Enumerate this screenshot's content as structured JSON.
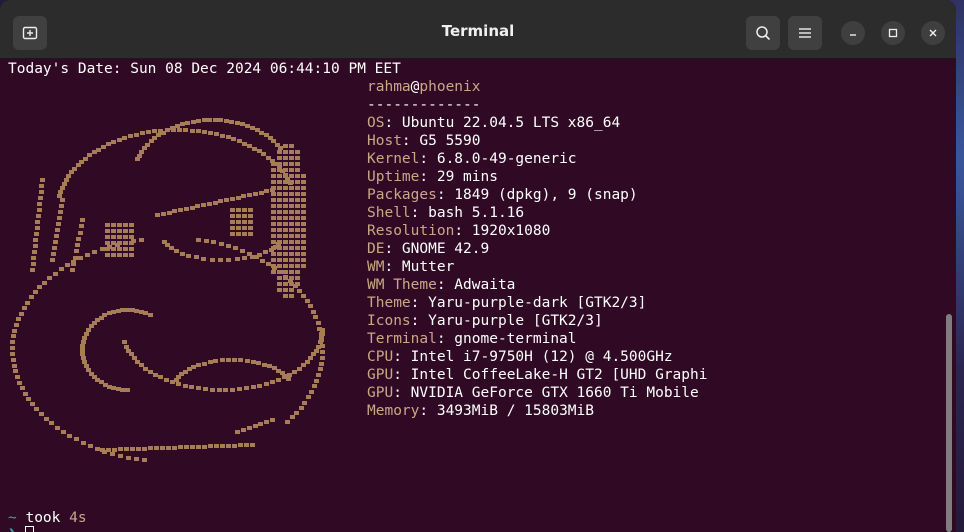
{
  "window": {
    "title": "Terminal",
    "new_tab_icon": "new-tab-icon",
    "search_icon": "search-icon",
    "menu_icon": "hamburger-menu-icon",
    "minimize_icon": "minimize-icon",
    "maximize_icon": "maximize-icon",
    "close_icon": "close-icon"
  },
  "terminal": {
    "date_line": "Today's Date: Sun 08 Dec 2024 06:44:10 PM EET",
    "user": "rahma",
    "at": "@",
    "host": "phoenix",
    "separator": "-------------",
    "info": [
      {
        "key": "OS",
        "value": ": Ubuntu 22.04.5 LTS x86_64"
      },
      {
        "key": "Host",
        "value": ": G5 5590"
      },
      {
        "key": "Kernel",
        "value": ": 6.8.0-49-generic"
      },
      {
        "key": "Uptime",
        "value": ": 29 mins"
      },
      {
        "key": "Packages",
        "value": ": 1849 (dpkg), 9 (snap)"
      },
      {
        "key": "Shell",
        "value": ": bash 5.1.16"
      },
      {
        "key": "Resolution",
        "value": ": 1920x1080"
      },
      {
        "key": "DE",
        "value": ": GNOME 42.9"
      },
      {
        "key": "WM",
        "value": ": Mutter"
      },
      {
        "key": "WM Theme",
        "value": ": Adwaita"
      },
      {
        "key": "Theme",
        "value": ": Yaru-purple-dark [GTK2/3]"
      },
      {
        "key": "Icons",
        "value": ": Yaru-purple [GTK2/3]"
      },
      {
        "key": "Terminal",
        "value": ": gnome-terminal"
      },
      {
        "key": "CPU",
        "value": ": Intel i7-9750H (12) @ 4.500GHz"
      },
      {
        "key": "GPU",
        "value": ": Intel CoffeeLake-H GT2 [UHD Graphi"
      },
      {
        "key": "GPU",
        "value": ": NVIDIA GeForce GTX 1660 Ti Mobile"
      },
      {
        "key": "Memory",
        "value": ": 3493MiB / 15803MiB"
      }
    ],
    "prompt_dir": "~",
    "prompt_text": " took ",
    "prompt_time": "4s",
    "prompt_symbol": "❯"
  },
  "colors": {
    "background": "#300a24",
    "label": "#c8a987",
    "art": "#a67d57",
    "prompt_accent": "#3aa6a0"
  }
}
